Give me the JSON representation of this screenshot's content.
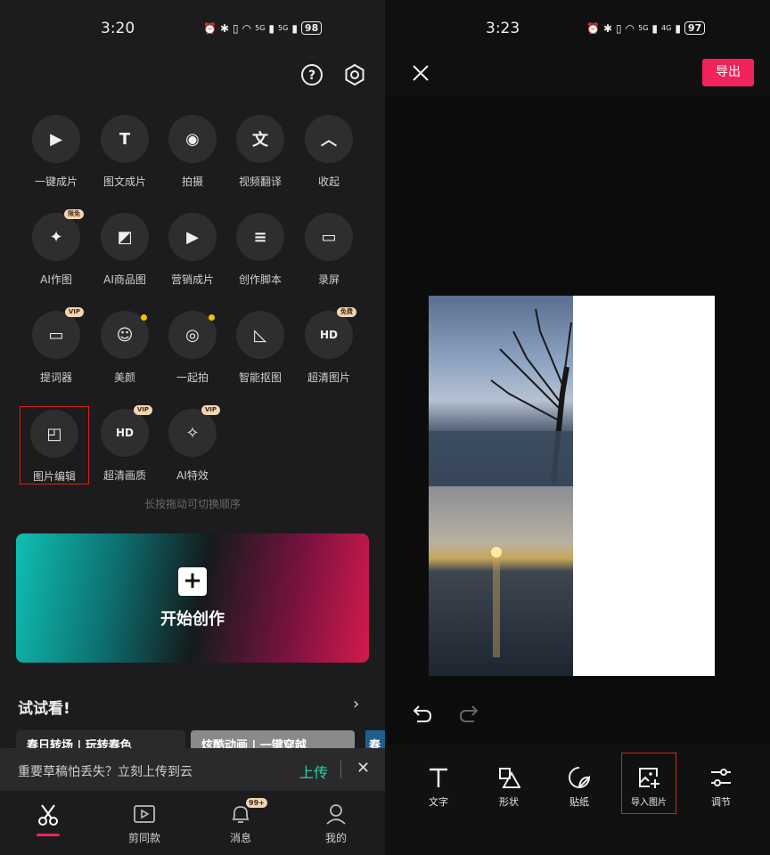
{
  "left": {
    "status": {
      "time": "3:20",
      "battery": "98",
      "net1": "5G",
      "net2": "5G"
    },
    "header": {
      "help_icon": "question-circle-icon",
      "settings_icon": "gear-icon"
    },
    "tools": [
      {
        "label": "一键成片",
        "icon": "play-lightning-icon"
      },
      {
        "label": "图文成片",
        "icon": "text-ai-icon"
      },
      {
        "label": "拍摄",
        "icon": "camera-icon"
      },
      {
        "label": "视频翻译",
        "icon": "translate-icon"
      },
      {
        "label": "收起",
        "icon": "chevron-up-icon"
      },
      {
        "label": "AI作图",
        "icon": "image-sparkle-icon",
        "badge": "限免"
      },
      {
        "label": "AI商品图",
        "icon": "image-ai-icon"
      },
      {
        "label": "营销成片",
        "icon": "marketing-icon"
      },
      {
        "label": "创作脚本",
        "icon": "script-icon"
      },
      {
        "label": "录屏",
        "icon": "record-icon"
      },
      {
        "label": "提词器",
        "icon": "teleprompter-icon",
        "badge": "VIP"
      },
      {
        "label": "美颜",
        "icon": "beauty-icon"
      },
      {
        "label": "一起拍",
        "icon": "duet-icon"
      },
      {
        "label": "智能抠图",
        "icon": "cutout-icon"
      },
      {
        "label": "超清图片",
        "icon": "hd-image-icon",
        "badge": "免费"
      },
      {
        "label": "图片编辑",
        "icon": "image-edit-icon"
      },
      {
        "label": "超清画质",
        "icon": "hd-icon",
        "badge": "VIP"
      },
      {
        "label": "AI特效",
        "icon": "magic-wand-icon",
        "badge": "VIP"
      }
    ],
    "hint": "长按拖动可切换顺序",
    "start": {
      "label": "开始创作",
      "plus": "+"
    },
    "try": {
      "title": "试试看!",
      "card1": "春日转场 | 玩转春色",
      "card2": "炫酷动画 | 一键穿越",
      "card3": "春"
    },
    "upload": {
      "text": "重要草稿怕丢失？立刻上传到云",
      "action": "上传"
    },
    "nav": [
      {
        "label": "",
        "icon": "scissors-icon"
      },
      {
        "label": "剪同款",
        "icon": "template-icon"
      },
      {
        "label": "消息",
        "icon": "bell-icon",
        "badge": "99+"
      },
      {
        "label": "我的",
        "icon": "user-icon"
      }
    ]
  },
  "right": {
    "status": {
      "time": "3:23",
      "battery": "97",
      "net1": "5G",
      "net2": "4G"
    },
    "export_label": "导出",
    "tools": [
      {
        "label": "文字",
        "icon": "text-icon"
      },
      {
        "label": "形状",
        "icon": "shapes-icon"
      },
      {
        "label": "贴纸",
        "icon": "sticker-icon"
      },
      {
        "label": "导入图片",
        "icon": "import-image-icon"
      },
      {
        "label": "调节",
        "icon": "adjust-icon"
      }
    ]
  },
  "colors": {
    "accent": "#f0245a",
    "highlight": "#d92020",
    "upload": "#2fd0a0"
  }
}
